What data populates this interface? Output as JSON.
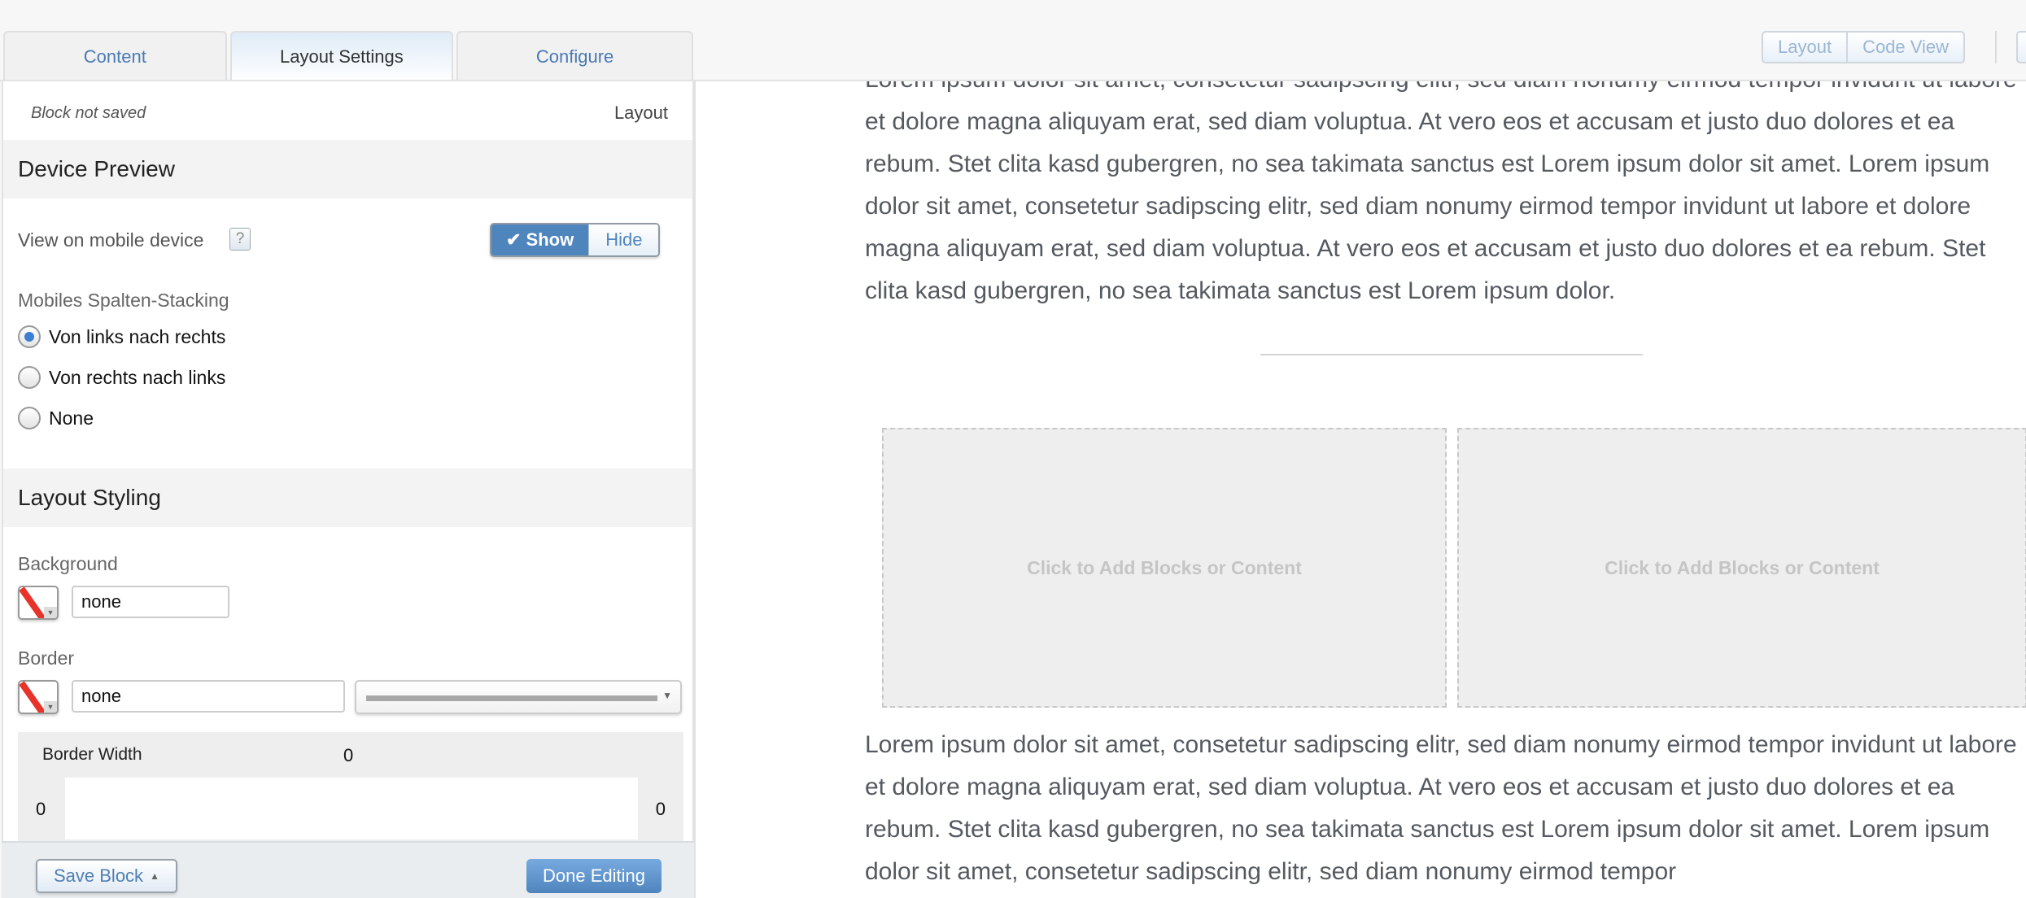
{
  "topbar": {
    "view_toggle": [
      "Layout",
      "Code View"
    ]
  },
  "panel": {
    "tabs": [
      {
        "label": "Content",
        "active": false
      },
      {
        "label": "Layout Settings",
        "active": true
      },
      {
        "label": "Configure",
        "active": false
      }
    ],
    "status": "Block not saved",
    "mode": "Layout",
    "device_preview": {
      "heading": "Device Preview",
      "view_on_mobile_label": "View on mobile device",
      "help_icon": "?",
      "show_label": "Show",
      "hide_label": "Hide",
      "selected": "Show",
      "stacking_label": "Mobiles Spalten-Stacking",
      "stacking_options": [
        {
          "label": "Von links nach rechts",
          "checked": true
        },
        {
          "label": "Von rechts nach links",
          "checked": false
        },
        {
          "label": "None",
          "checked": false
        }
      ]
    },
    "layout_styling": {
      "heading": "Layout Styling",
      "background_label": "Background",
      "background_value": "none",
      "border_label": "Border",
      "border_value": "none",
      "border_width_label": "Border Width",
      "border_width_top": "0",
      "border_width_left": "0",
      "border_width_right": "0"
    },
    "footer": {
      "save_label": "Save Block",
      "done_label": "Done Editing"
    }
  },
  "content": {
    "paragraph_top": "Lorem ipsum dolor sit amet, consetetur sadipscing elitr, sed diam nonumy eirmod tempor invidunt ut labore et dolore magna aliquyam erat, sed diam voluptua. At vero eos et accusam et justo duo dolores et ea rebum. Stet clita kasd gubergren, no sea takimata sanctus est Lorem ipsum dolor sit amet. Lorem ipsum dolor sit amet, consetetur sadipscing elitr, sed diam nonumy eirmod tempor invidunt ut labore et dolore magna aliquyam erat, sed diam voluptua. At vero eos et accusam et justo duo dolores et ea rebum. Stet clita kasd gubergren, no sea takimata sanctus est Lorem ipsum dolor.",
    "placeholders": [
      "Click to Add Blocks or Content",
      "Click to Add Blocks or Content"
    ],
    "paragraph_bottom": "Lorem ipsum dolor sit amet, consetetur sadipscing elitr, sed diam nonumy eirmod tempor invidunt ut labore et dolore magna aliquyam erat, sed diam voluptua. At vero eos et accusam et justo duo dolores et ea rebum. Stet clita kasd gubergren, no sea takimata sanctus est Lorem ipsum dolor sit amet. Lorem ipsum dolor sit amet, consetetur sadipscing elitr, sed diam nonumy eirmod tempor"
  },
  "colors": {
    "accent": "#4f85bd",
    "tab_link": "#4a7ab5",
    "swatch_none": "#e8332a",
    "body_text": "#555a60",
    "placeholder_text": "#c5c5c5"
  }
}
